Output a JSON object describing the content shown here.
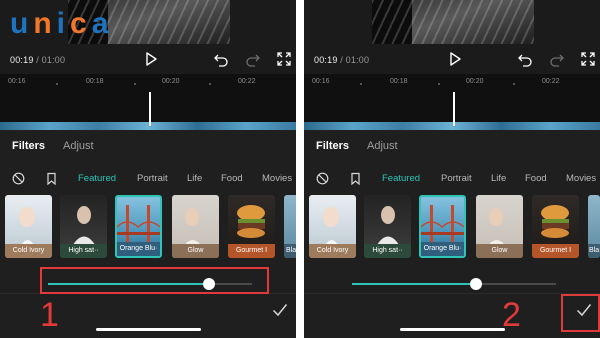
{
  "logo": {
    "text": "unica",
    "parts": [
      {
        "t": "u",
        "c": "blue"
      },
      {
        "t": "n",
        "c": "orange"
      },
      {
        "t": "i",
        "c": "blue"
      },
      {
        "t": "c",
        "c": "orange"
      },
      {
        "t": "a",
        "c": "blue"
      }
    ]
  },
  "colors": {
    "accent": "#2ec4b6",
    "annotation": "#e03a3a",
    "logo_blue": "#1e73be",
    "logo_orange": "#f2772a"
  },
  "icons": {
    "play": "play-icon",
    "undo": "undo-icon",
    "redo": "redo-icon",
    "fullscreen": "fullscreen-icon",
    "reset": "no-filter-icon",
    "bookmark": "bookmark-icon",
    "confirm": "checkmark-icon"
  },
  "panels": [
    {
      "time_current": "00:19",
      "time_separator": "/",
      "time_total": "01:00",
      "timeline_ticks": [
        "00:16",
        "00:18",
        "00:20",
        "00:22"
      ],
      "tabs": [
        "Filters",
        "Adjust"
      ],
      "categories": [
        "Featured",
        "Portrait",
        "Life",
        "Food",
        "Movies"
      ],
      "active_category": "Featured",
      "filters": [
        "Cold Ivory",
        "High sat··",
        "Orange Blu·",
        "Glow",
        "Gourmet I",
        "Bla"
      ],
      "selected_filter": "Orange Blu·",
      "intensity": 0.79,
      "step_number": "1",
      "highlight": "slider"
    },
    {
      "time_current": "00:19",
      "time_separator": "/",
      "time_total": "01:00",
      "timeline_ticks": [
        "00:16",
        "00:18",
        "00:20",
        "00:22"
      ],
      "tabs": [
        "Filters",
        "Adjust"
      ],
      "categories": [
        "Featured",
        "Portrait",
        "Life",
        "Food",
        "Movies"
      ],
      "active_category": "Featured",
      "filters": [
        "Cold Ivory",
        "High sat··",
        "Orange Blu·",
        "Glow",
        "Gourmet I",
        "Bla"
      ],
      "selected_filter": "Orange Blu·",
      "intensity": 0.61,
      "step_number": "2",
      "highlight": "confirm"
    }
  ]
}
